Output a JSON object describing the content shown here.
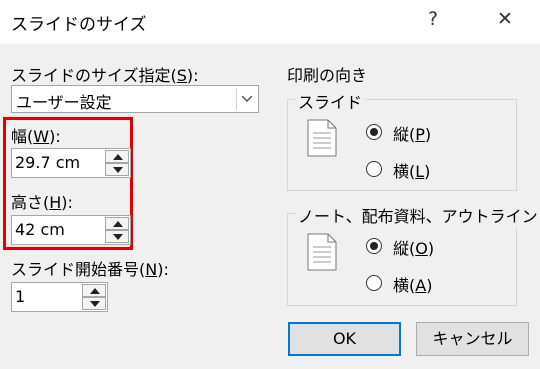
{
  "window": {
    "title": "スライドのサイズ",
    "help_label": "?",
    "close_label": "✕"
  },
  "slide_size": {
    "label_prefix": "スライドのサイズ指定(",
    "label_key": "S",
    "label_suffix": "):",
    "selected": "ユーザー設定"
  },
  "width": {
    "label_prefix": "幅(",
    "label_key": "W",
    "label_suffix": "):",
    "value": "29.7 cm"
  },
  "height": {
    "label_prefix": "高さ(",
    "label_key": "H",
    "label_suffix": "):",
    "value": "42 cm"
  },
  "start_number": {
    "label_prefix": "スライド開始番号(",
    "label_key": "N",
    "label_suffix": "):",
    "value": "1"
  },
  "orientation": {
    "title": "印刷の向き",
    "slides": {
      "title": "スライド",
      "portrait": {
        "prefix": "縦(",
        "key": "P",
        "suffix": ")",
        "checked": true
      },
      "landscape": {
        "prefix": "横(",
        "key": "L",
        "suffix": ")",
        "checked": false
      }
    },
    "notes": {
      "title": "ノート、配布資料、アウトライン",
      "portrait": {
        "prefix": "縦(",
        "key": "O",
        "suffix": ")",
        "checked": true
      },
      "landscape": {
        "prefix": "横(",
        "key": "A",
        "suffix": ")",
        "checked": false
      }
    }
  },
  "buttons": {
    "ok": "OK",
    "cancel": "キャンセル"
  },
  "colors": {
    "highlight": "#e00000",
    "focus": "#0078d7"
  }
}
